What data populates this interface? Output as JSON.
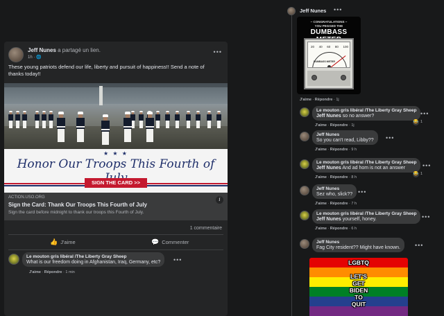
{
  "post": {
    "author": "Jeff Nunes",
    "shared_text": " a partagé un lien.",
    "time": "1h · ",
    "globe": "🌐",
    "menu": "•••",
    "text": "These young patriots defend our life, liberty and pursuit of happiness!! Send a note of thanks today!!",
    "banner_stars": "★ ★ ★",
    "banner_title": "Honor Our Troops This Fourth of July",
    "banner_button": "SIGN THE CARD >>",
    "link_domain": "ACTION.USO.ORG",
    "link_title": "Sign the Card: Thank Our Troops This Fourth of July",
    "link_desc": "Sign the card before midnight to thank our troops this Fourth of July.",
    "info_icon": "i",
    "comment_count": "1 commentaire",
    "like_label": "J'aime",
    "comment_label": "Commenter",
    "like_icon": "👍",
    "comment_icon": "💬"
  },
  "left_comment": {
    "name": "Le mouton gris libéral /The Liberty Gray Sheep",
    "text": "What is our freedom doing in Afghanistan, Iraq, Germany, etc?",
    "like": "J'aime",
    "sep": " · ",
    "reply": "Répondre",
    "time": "1 min",
    "menu": "•••"
  },
  "thread": {
    "header_name": "Jeff Nunes",
    "header_menu": "•••",
    "meme_top": "~ CONGRATULATIONS ~\nYOU PEGGED THE",
    "meme_title": "DUMBASS METER",
    "meme_nums": [
      "20",
      "40",
      "60",
      "80",
      "100"
    ],
    "meme_label": "DUMBASS METER",
    "like": "J'aime",
    "reply": "Répondre",
    "sep": " · ",
    "meme_time": "1j",
    "comments": [
      {
        "name": "Le mouton gris libéral /The Liberty Gray Sheep",
        "mention": "Jeff Nunes",
        "text": " so no answer?",
        "time": "1j",
        "reaction": "😂",
        "reaction_count": "1"
      },
      {
        "name": "Jeff Nunes",
        "mention": "",
        "text": "So you can't read, Libby??",
        "time": "9 h"
      },
      {
        "name": "Le mouton gris libéral /The Liberty Gray Sheep",
        "mention": "Jeff Nunes",
        "text": " And ad hom is not an answer",
        "time": "8 h",
        "reaction": "😂",
        "reaction_count": "1"
      },
      {
        "name": "Jeff Nunes",
        "mention": "",
        "text": "Sez who, slick??",
        "time": "7 h"
      },
      {
        "name": "Le mouton gris libéral /The Liberty Gray Sheep",
        "mention": "Jeff Nunes",
        "text": " yourself, honey.",
        "time": "6 h"
      },
      {
        "name": "Jeff Nunes",
        "mention": "",
        "text": "Fag City resident?? Might have known.",
        "time": ""
      }
    ],
    "comment_menu": "•••",
    "rainbow_lines": [
      "LGBTQ",
      "",
      "LET'S",
      "GET",
      "BIDEN",
      "TO",
      "QUIT"
    ],
    "rainbow_colors": [
      "#e40303",
      "#ff8c00",
      "#ffed00",
      "#008026",
      "#24408e",
      "#732982"
    ]
  }
}
